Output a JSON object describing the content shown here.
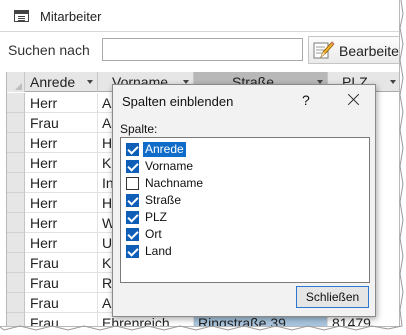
{
  "window": {
    "title": "Mitarbeiter"
  },
  "search": {
    "label": "Suchen nach",
    "value": ""
  },
  "toolbar": {
    "edit_label": "Bearbeiten"
  },
  "table": {
    "columns": [
      "Anrede",
      "Vorname",
      "Straße",
      "PLZ"
    ],
    "rows": [
      [
        "Herr",
        "An",
        "",
        ""
      ],
      [
        "Frau",
        "Ad",
        "",
        ""
      ],
      [
        "Herr",
        "Ha",
        "",
        ""
      ],
      [
        "Herr",
        "Kn",
        "",
        ""
      ],
      [
        "Herr",
        "Ing",
        "",
        ""
      ],
      [
        "Herr",
        "He",
        "",
        ""
      ],
      [
        "Herr",
        "We",
        "",
        ""
      ],
      [
        "Herr",
        "Un",
        "",
        ""
      ],
      [
        "Frau",
        "Ka",
        "",
        ""
      ],
      [
        "Frau",
        "Ro",
        "",
        ""
      ],
      [
        "Frau",
        "Alb",
        "",
        ""
      ],
      [
        "Frau",
        "Ehrenreich",
        "Ringstraße 39",
        "81479"
      ]
    ]
  },
  "dialog": {
    "title": "Spalten einblenden",
    "help": "?",
    "list_label": "Spalte:",
    "items": [
      {
        "label": "Anrede",
        "checked": true,
        "selected": true
      },
      {
        "label": "Vorname",
        "checked": true,
        "selected": false
      },
      {
        "label": "Nachname",
        "checked": false,
        "selected": false
      },
      {
        "label": "Straße",
        "checked": true,
        "selected": false
      },
      {
        "label": "PLZ",
        "checked": true,
        "selected": false
      },
      {
        "label": "Ort",
        "checked": true,
        "selected": false
      },
      {
        "label": "Land",
        "checked": true,
        "selected": false
      }
    ],
    "close_label": "Schließen"
  },
  "colors": {
    "accent": "#0f6cc9",
    "column_highlight": "#a9c6df"
  }
}
